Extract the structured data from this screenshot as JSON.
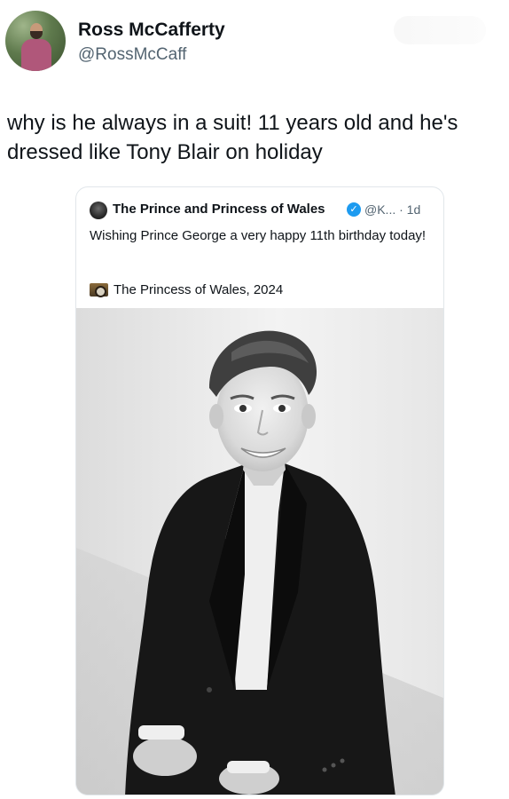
{
  "author": {
    "name": "Ross McCafferty",
    "handle": "@RossMcCaff",
    "avatar_icon": "profile-photo"
  },
  "tweet": {
    "text": "why is he always in a suit! 11 years old and he's dressed like Tony Blair on holiday"
  },
  "quoted_tweet": {
    "name": "The Prince and Princess of Wales",
    "verified_icon": "verified-badge-icon",
    "handle_time": "@K... · 1d",
    "text": "Wishing Prince George a very happy 11th birthday today!",
    "credit_icon": "camera-icon",
    "credit": "The Princess of Wales, 2024",
    "media": "black-and-white portrait photo of a boy in a suit"
  },
  "colors": {
    "text": "#0f1419",
    "muted": "#536471",
    "verified": "#1d9bf0",
    "border": "#e1e6ea"
  }
}
